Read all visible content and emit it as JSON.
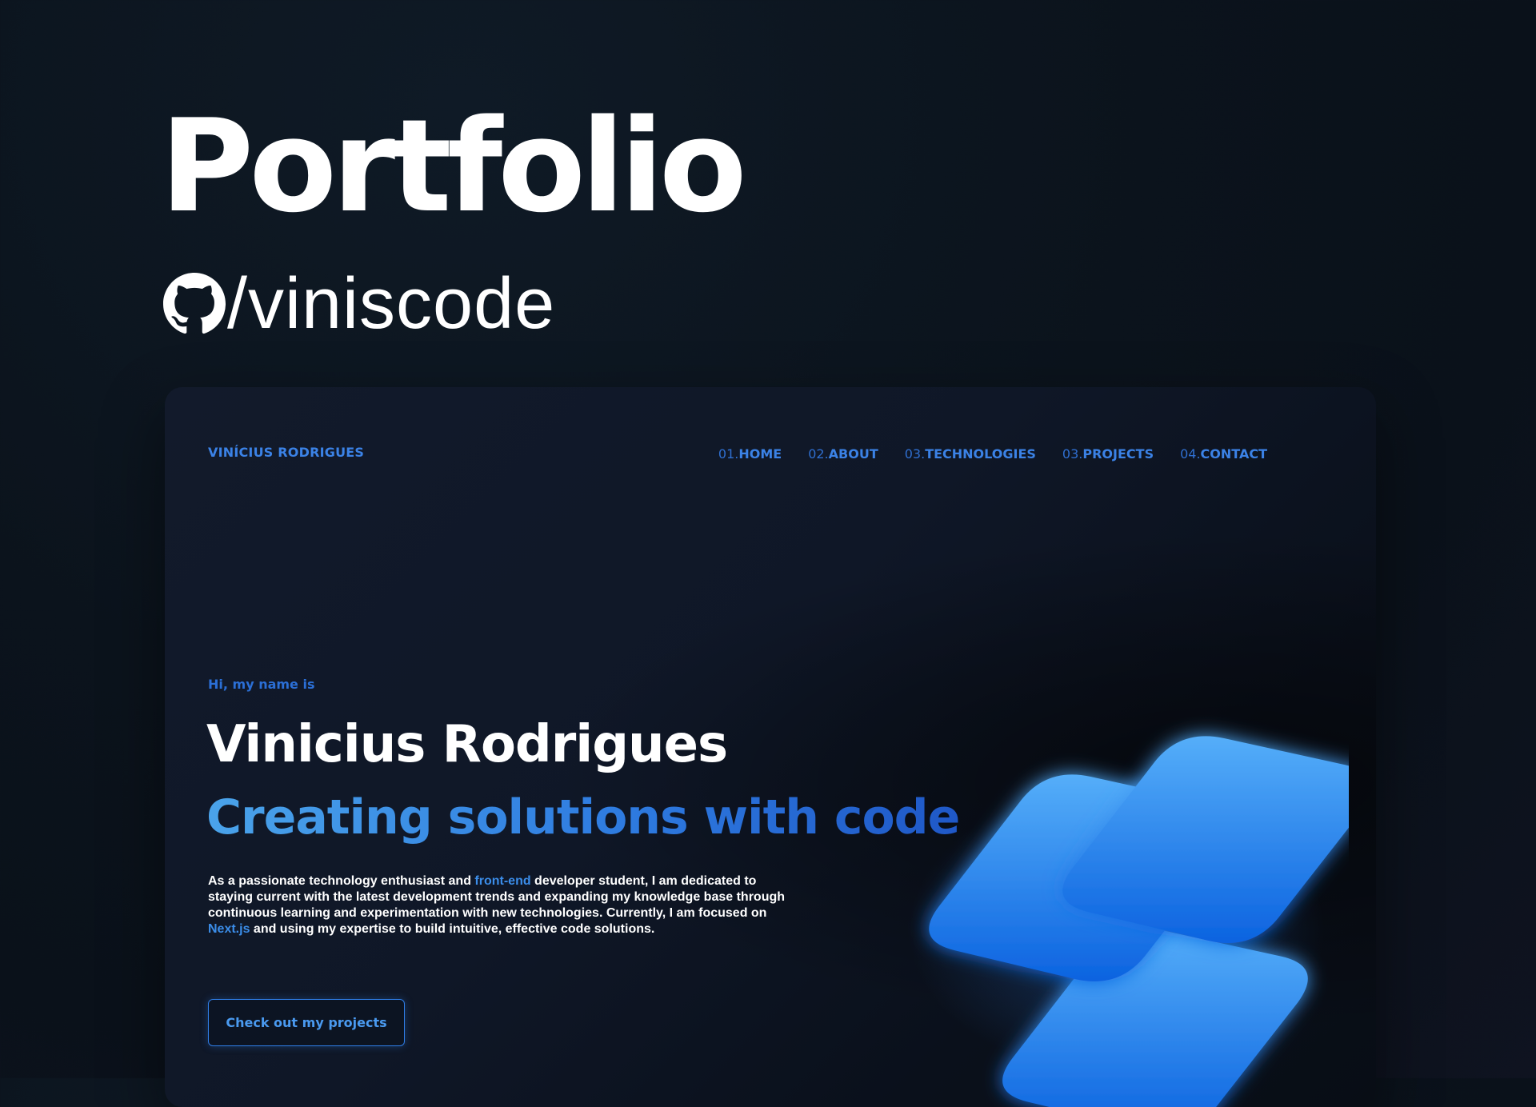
{
  "poster": {
    "title": "Portfolio",
    "github_handle": "/viniscode",
    "github_icon": "github-icon"
  },
  "site": {
    "brand": "VINÍCIUS RODRIGUES",
    "nav": [
      {
        "num": "01.",
        "label": "HOME"
      },
      {
        "num": "02.",
        "label": "ABOUT"
      },
      {
        "num": "03.",
        "label": "TECHNOLOGIES"
      },
      {
        "num": "03.",
        "label": "PROJECTS"
      },
      {
        "num": "04.",
        "label": "CONTACT"
      }
    ],
    "hero": {
      "greeting": "Hi, my name is",
      "name": "Vinicius Rodrigues",
      "tagline": "Creating solutions with code",
      "desc_part1": "As a passionate technology enthusiast and ",
      "desc_highlight1": "front-end",
      "desc_part2": " developer student, I am dedicated to staying current with the latest development trends and expanding my knowledge base through continuous learning and experimentation with new technologies. Currently, I am focused on ",
      "desc_highlight2": "Next.js",
      "desc_part3": " and using my expertise to build intuitive, effective code solutions.",
      "cta_label": "Check out my projects"
    }
  },
  "colors": {
    "accent": "#3b82e6",
    "background": "#0b131c",
    "card": "#0f1727",
    "tile": "#2f80ed"
  }
}
